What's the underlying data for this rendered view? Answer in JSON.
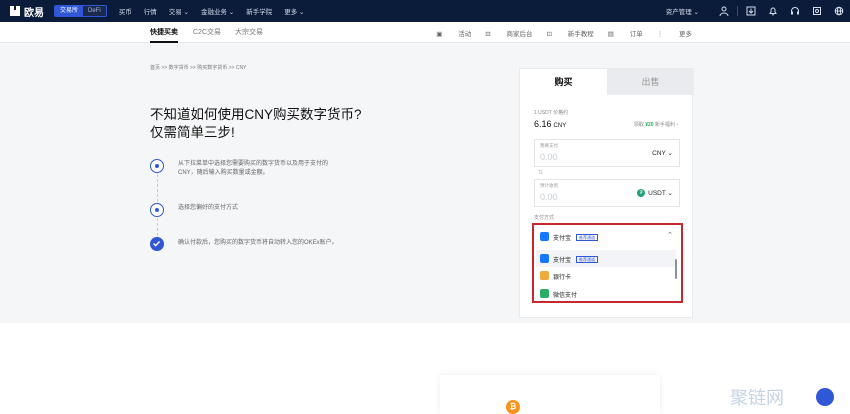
{
  "topnav": {
    "logo": "欧易",
    "mode_active": "交易所",
    "mode_other": "DeFi",
    "menu": [
      "买币",
      "行情",
      "交易 ⌄",
      "金融业务 ⌄",
      "新手学院",
      "更多 ⌄"
    ],
    "asset": "资产管理 ⌄"
  },
  "subnav": {
    "tabs": [
      "快捷买卖",
      "C2C交易",
      "大宗交易"
    ],
    "links": [
      "活动",
      "商家后台",
      "新手教程",
      "订单",
      "更多"
    ]
  },
  "hero": {
    "breadcrumb": "首页 >> 数字货币 >> 购买数字货币 >> CNY",
    "title_line1": "不知道如何使用CNY购买数字货币?",
    "title_line2": "仅需简单三步!",
    "steps": [
      {
        "line1": "从下拉菜单中选择您需要购买的数字货币以及用于支付的",
        "line2": "CNY，随后输入购买数量或金额。"
      },
      {
        "line1": "选择您偏好的支付方式",
        "line2": ""
      },
      {
        "line1": "确认付款后，您购买的数字货币将自动转入您的OKEx账户。",
        "line2": ""
      }
    ]
  },
  "trade_card": {
    "tab_buy": "购买",
    "tab_sell": "出售",
    "rate_label": "1 USDT 价格约",
    "rate_value": "6.16",
    "rate_unit": "CNY",
    "promo_prefix": "领取",
    "promo_amount": "¥20",
    "promo_suffix": "新手福利",
    "pay_field": {
      "label": "我要支付",
      "placeholder": "0.00",
      "currency": "CNY ⌄"
    },
    "receive_field": {
      "label": "预计收到",
      "placeholder": "0.00",
      "currency": "USDT ⌄"
    },
    "pay_method_label": "支付方式",
    "selected_method": "支付宝",
    "selected_tag": "推荐通道",
    "options": [
      {
        "name": "支付宝",
        "tag": "推荐通道"
      },
      {
        "name": "银行卡",
        "tag": ""
      },
      {
        "name": "微信支付",
        "tag": ""
      }
    ]
  },
  "colors": {
    "nav_bg": "#0b1b3a",
    "accent": "#2f57d6",
    "highlight_box": "#c8282d",
    "alipay": "#1677ff",
    "bank": "#f0a93b",
    "wechat": "#2aae67"
  },
  "watermark": "聚链网"
}
